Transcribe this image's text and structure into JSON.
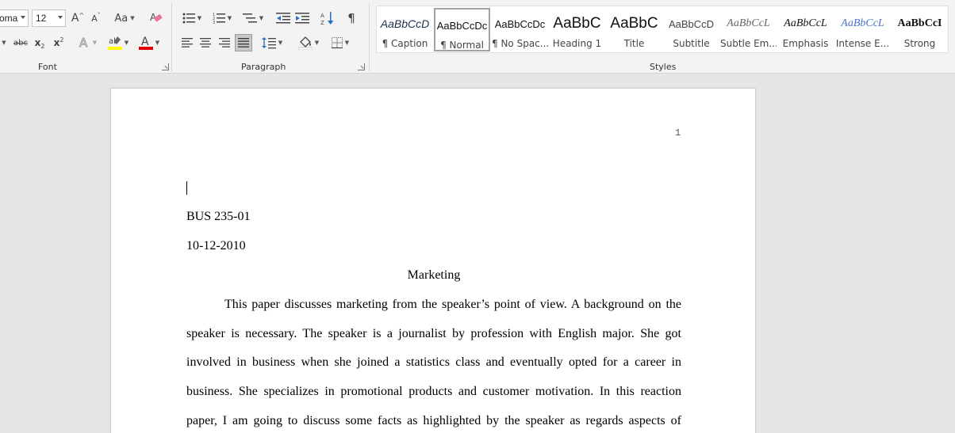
{
  "ribbon": {
    "font_group": {
      "label": "Font",
      "font_name": "oma",
      "font_size": "12",
      "grow_font": "A",
      "shrink_font": "A",
      "change_case": "Aa",
      "strikethrough": "abc",
      "subscript": "x",
      "superscript": "x",
      "highlight_color": "#ffff00",
      "font_color": "#e00000"
    },
    "paragraph_group": {
      "label": "Paragraph"
    },
    "styles_group": {
      "label": "Styles",
      "items": [
        {
          "preview": "AaBbCcD",
          "name": "¶ Caption"
        },
        {
          "preview": "AaBbCcDc",
          "name": "¶ Normal"
        },
        {
          "preview": "AaBbCcDc",
          "name": "¶ No Spac..."
        },
        {
          "preview": "AaBbC",
          "name": "Heading 1"
        },
        {
          "preview": "AaBbC",
          "name": "Title"
        },
        {
          "preview": "AaBbCcD",
          "name": "Subtitle"
        },
        {
          "preview": "AaBbCcL",
          "name": "Subtle Em..."
        },
        {
          "preview": "AaBbCcL",
          "name": "Emphasis"
        },
        {
          "preview": "AaBbCcL",
          "name": "Intense E..."
        },
        {
          "preview": "AaBbCcI",
          "name": "Strong"
        }
      ],
      "selected_index": 1
    }
  },
  "document": {
    "page_number": "1",
    "lines": {
      "course": "BUS 235-01",
      "date": "10-12-2010",
      "title": "Marketing"
    },
    "body": [
      "This paper discusses marketing from the speaker’s point of view.  A background on the",
      "speaker is necessary. The speaker is a journalist by profession with English major. She got",
      "involved in business when she joined a statistics class and eventually opted for a career in",
      "business. She specializes in promotional products and customer motivation. In this reaction",
      "paper, I am going to discuss some facts as highlighted by the speaker as regards aspects of"
    ]
  }
}
